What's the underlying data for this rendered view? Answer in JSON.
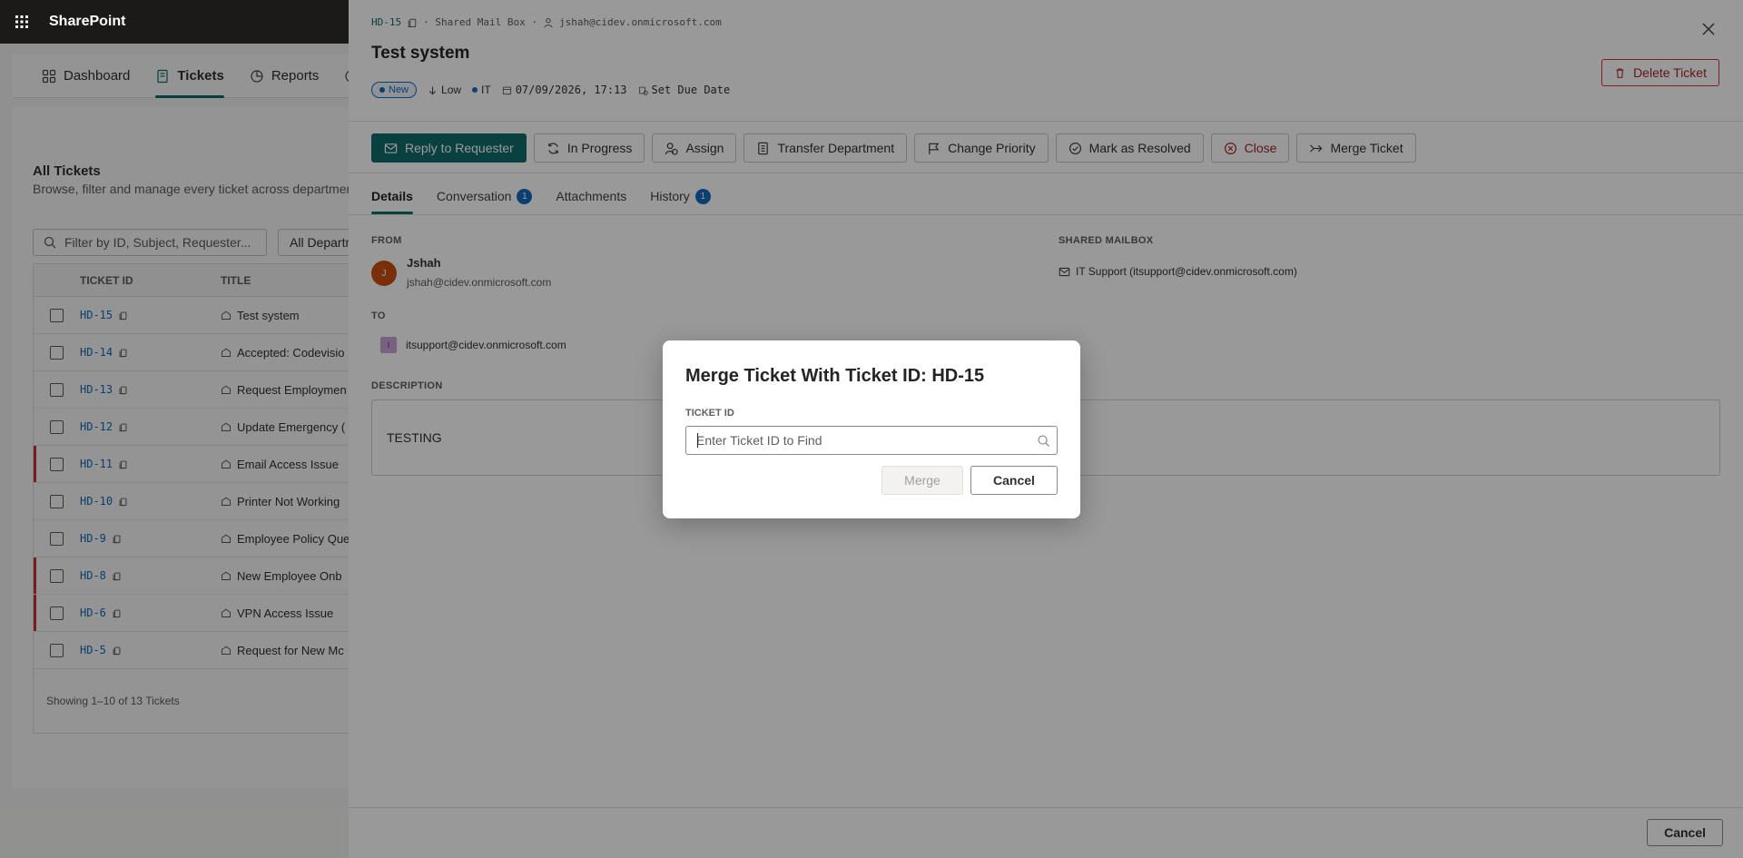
{
  "suite": {
    "brand": "SharePoint"
  },
  "app": {
    "nav": [
      {
        "label": "Dashboard",
        "icon": "grid-icon",
        "active": false
      },
      {
        "label": "Tickets",
        "icon": "ticket-icon",
        "active": true
      },
      {
        "label": "Reports",
        "icon": "chart-icon",
        "active": false
      }
    ],
    "list_title": "All Tickets",
    "list_subtitle": "Browse, filter and manage every ticket across departmen",
    "filter_placeholder": "Filter by ID, Subject, Requester...",
    "dept_filter": "All Departm",
    "columns": [
      "TICKET ID",
      "TITLE"
    ],
    "rows": [
      {
        "id": "HD-15",
        "title": "Test system",
        "flag": false
      },
      {
        "id": "HD-14",
        "title": "Accepted: Codevisio",
        "flag": false
      },
      {
        "id": "HD-13",
        "title": "Request Employmen",
        "flag": false
      },
      {
        "id": "HD-12",
        "title": "Update Emergency (",
        "flag": false
      },
      {
        "id": "HD-11",
        "title": "Email Access Issue",
        "flag": true
      },
      {
        "id": "HD-10",
        "title": "Printer Not Working",
        "flag": false
      },
      {
        "id": "HD-9",
        "title": "Employee Policy Que",
        "flag": false
      },
      {
        "id": "HD-8",
        "title": "New Employee Onb",
        "flag": true
      },
      {
        "id": "HD-6",
        "title": "VPN Access Issue",
        "flag": true
      },
      {
        "id": "HD-5",
        "title": "Request for New Mc",
        "flag": false
      }
    ],
    "footer": "Showing 1–10 of 13 Tickets"
  },
  "panel": {
    "ticket_id": "HD-15",
    "source": "· Shared Mail Box ·",
    "requester_email": "jshah@cidev.onmicrosoft.com",
    "title": "Test system",
    "status": "New",
    "priority": "Low",
    "department": "IT",
    "created": "07/09/2026, 17:13",
    "due": "Set Due Date",
    "delete_label": "Delete Ticket",
    "actions": [
      {
        "label": "Reply to Requester",
        "icon": "mail-icon",
        "kind": "primary"
      },
      {
        "label": "In Progress",
        "icon": "refresh-icon",
        "kind": "default"
      },
      {
        "label": "Assign",
        "icon": "person-add-icon",
        "kind": "default"
      },
      {
        "label": "Transfer Department",
        "icon": "building-icon",
        "kind": "default"
      },
      {
        "label": "Change Priority",
        "icon": "flag-icon",
        "kind": "default"
      },
      {
        "label": "Mark as Resolved",
        "icon": "check-circle-icon",
        "kind": "default"
      },
      {
        "label": "Close",
        "icon": "dismiss-circle-icon",
        "kind": "danger"
      },
      {
        "label": "Merge Ticket",
        "icon": "merge-icon",
        "kind": "default"
      }
    ],
    "tabs": [
      {
        "label": "Details",
        "count": "",
        "active": true
      },
      {
        "label": "Conversation",
        "count": "1",
        "active": false
      },
      {
        "label": "Attachments",
        "count": "",
        "active": false
      },
      {
        "label": "History",
        "count": "1",
        "active": false
      }
    ],
    "from_label": "FROM",
    "from_initial": "J",
    "from_name": "Jshah",
    "from_email": "jshah@cidev.onmicrosoft.com",
    "to_label": "TO",
    "to_initial": "I",
    "to_email": "itsupport@cidev.onmicrosoft.com",
    "mailbox_label": "SHARED MAILBOX",
    "mailbox_value": "IT Support (itsupport@cidev.onmicrosoft.com)",
    "description_label": "DESCRIPTION",
    "description": "TESTING",
    "footer_cancel": "Cancel"
  },
  "modal": {
    "title": "Merge Ticket With Ticket ID: HD-15",
    "field_label": "TICKET ID",
    "placeholder": "Enter Ticket ID to Find",
    "value": "",
    "merge_label": "Merge",
    "cancel_label": "Cancel"
  }
}
